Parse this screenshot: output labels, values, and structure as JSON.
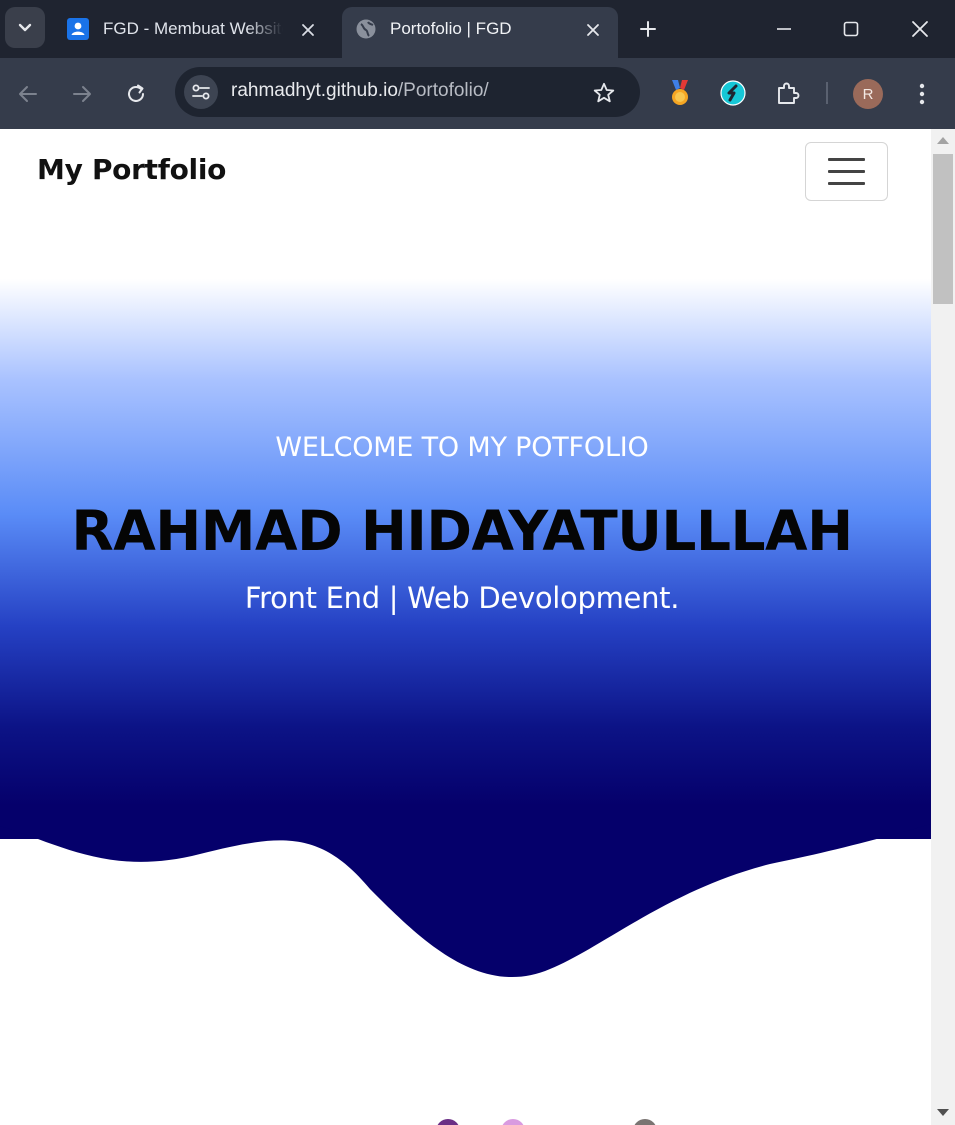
{
  "browser": {
    "tabs": [
      {
        "title": "FGD - Membuat Website",
        "active": false,
        "favicon": "google-classroom-icon"
      },
      {
        "title": "Portofolio | FGD",
        "active": true,
        "favicon": "globe-icon"
      }
    ],
    "address": {
      "host": "rahmadhyt.github.io",
      "path": "/Portofolio/"
    },
    "profile_initial": "R",
    "extensions": [
      "medal-extension-icon",
      "sync-extension-icon",
      "puzzle-extensions-icon"
    ]
  },
  "page": {
    "brand": "My Portfolio",
    "hero": {
      "welcome": "WELCOME TO MY POTFOLIO",
      "name": "RAHMAD HIDAYATULLLAH",
      "tagline": "Front End | Web Devolopment."
    },
    "colors": {
      "hero_dark": "#05006b",
      "hero_mid": "#2541c4",
      "hero_light": "#5a8cf7",
      "chrome_bg": "#1f2430",
      "toolbar_bg": "#353c4b"
    }
  }
}
